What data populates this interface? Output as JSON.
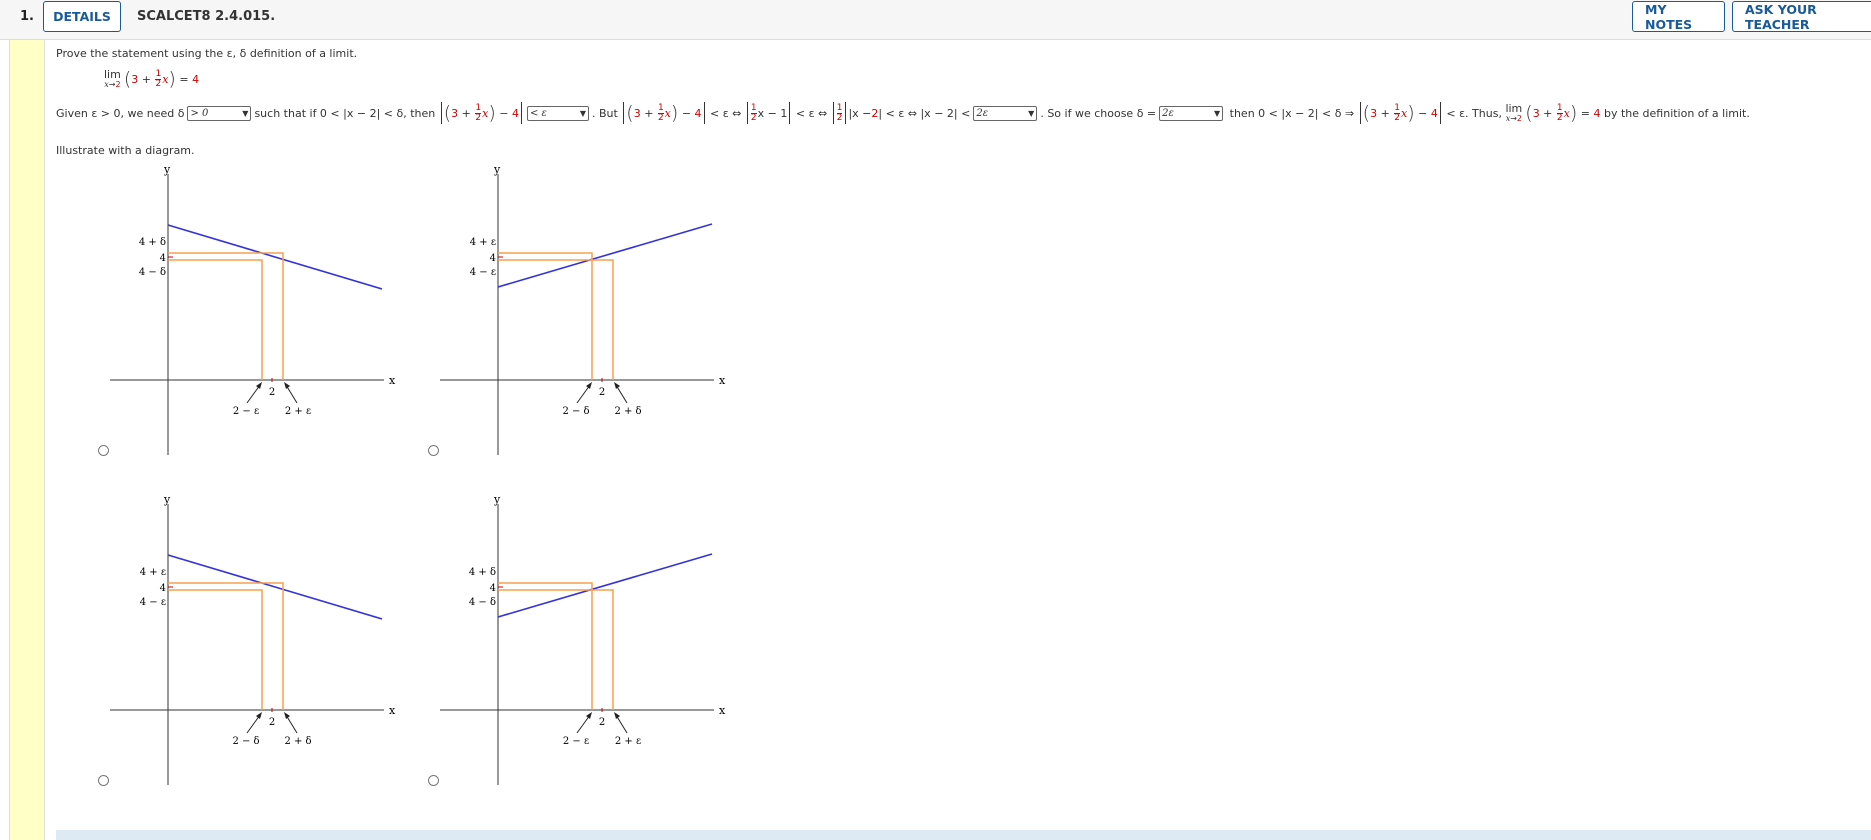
{
  "header": {
    "question_number": "1.",
    "details_label": "DETAILS",
    "question_id": "SCALCET8 2.4.015.",
    "my_notes_label": "MY NOTES",
    "ask_teacher_label": "ASK YOUR TEACHER"
  },
  "problem": {
    "prompt": "Prove the statement using the ε, δ definition of a limit.",
    "limit": {
      "lim": "lim",
      "subscript_var": "x",
      "subscript_arrow": "→",
      "subscript_to": "2",
      "constant": "3",
      "plus": "+",
      "frac_num": "1",
      "frac_den": "2",
      "var": "x",
      "equals": "=",
      "result": "4"
    },
    "proof": {
      "given": "Given ε > 0, we need δ",
      "select1": "> 0",
      "such_that": "such that if 0 < |x − 2| < δ, then",
      "select2": "< ε",
      "but": ". But",
      "lt_eps_iff": "< ε ⇔",
      "minus_one": "x − 1",
      "lt_eps_iff2": "< ε ⇔",
      "abs_x_minus": "|x − ",
      "two": "2",
      "abs_close": "| < ε ⇔ |x − 2| <",
      "select3": "2ε",
      "so_if": ". So if we choose  δ =",
      "select4": "2ε",
      "then": "then  0 < |x − 2| < δ ⇒",
      "lt_eps": "< ε.",
      "thus": "Thus,",
      "by_def": "by the definition of a limit.",
      "minus_four": "− 4"
    },
    "illustrate": "Illustrate with a diagram."
  },
  "graphs": [
    {
      "slope": "negative",
      "y_labels": [
        "4 + δ",
        "4",
        "4 − δ"
      ],
      "x_labels": [
        "2",
        "2 − ε",
        "2 + ε"
      ],
      "axis_x": "x",
      "axis_y": "y"
    },
    {
      "slope": "positive",
      "y_labels": [
        "4 + ε",
        "4",
        "4 − ε"
      ],
      "x_labels": [
        "2",
        "2 − δ",
        "2 + δ"
      ],
      "axis_x": "x",
      "axis_y": "y"
    },
    {
      "slope": "negative",
      "y_labels": [
        "4 + ε",
        "4",
        "4 − ε"
      ],
      "x_labels": [
        "2",
        "2 − δ",
        "2 + δ"
      ],
      "axis_x": "x",
      "axis_y": "y"
    },
    {
      "slope": "positive",
      "y_labels": [
        "4 + δ",
        "4",
        "4 − δ"
      ],
      "x_labels": [
        "2",
        "2 − ε",
        "2 + ε"
      ],
      "axis_x": "x",
      "axis_y": "y"
    }
  ],
  "colors": {
    "accent": "#1a5a96",
    "line": "#3333dd",
    "guide": "#f5a050",
    "red": "#cc0000",
    "sidebar": "#ffffc6"
  }
}
